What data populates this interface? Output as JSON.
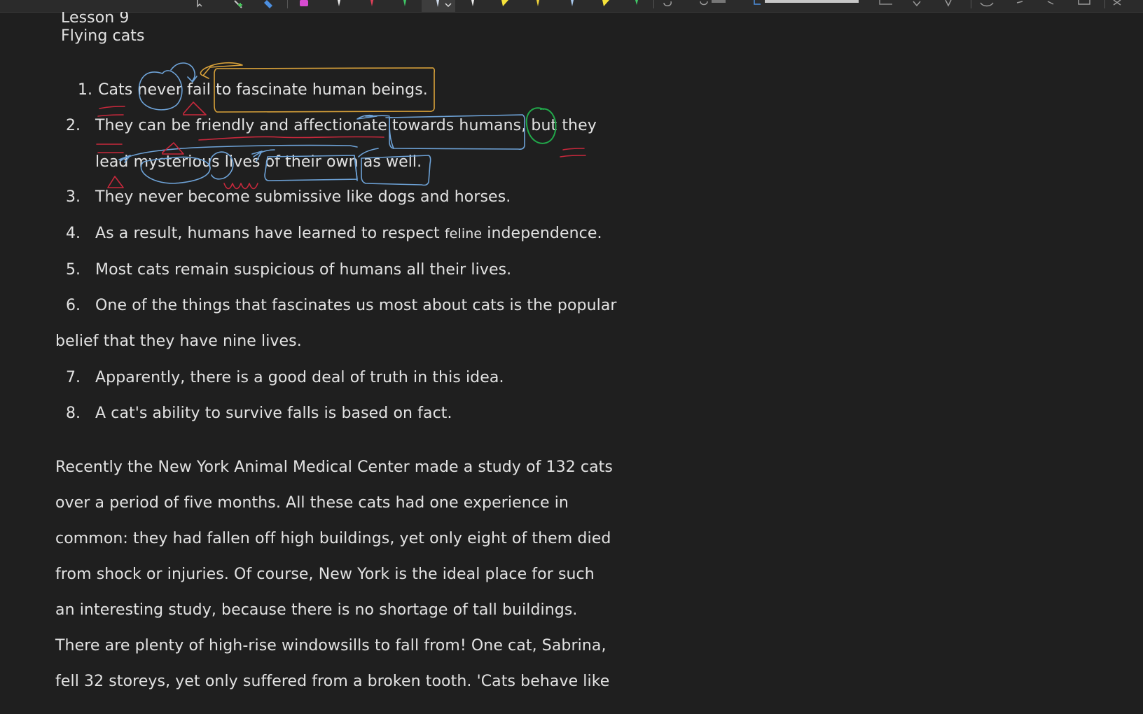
{
  "header": {
    "lesson": "Lesson 9",
    "title": "Flying cats"
  },
  "list": [
    {
      "num": "1.",
      "text": "Cats never fail to fascinate human beings."
    },
    {
      "num": "2.",
      "line1": "They can be friendly and affectionate towards humans, but they",
      "line2": "lead mysterious lives of their own as well."
    },
    {
      "num": "3.",
      "text": "They never become submissive like dogs and horses."
    },
    {
      "num": "4.",
      "text_a": "As a result, humans have learned to respect ",
      "text_small": "feline",
      "text_b": " independence."
    },
    {
      "num": "5.",
      "text": "Most cats remain suspicious of humans all their lives."
    },
    {
      "num": "6.",
      "line1": "One of the things that fascinates us most about cats is the popular",
      "line2": "belief that they have nine lives."
    },
    {
      "num": "7.",
      "text": "Apparently, there is a good deal of truth in this idea."
    },
    {
      "num": "8.",
      "text": "A cat's ability to survive falls is based on fact."
    }
  ],
  "paragraph": [
    "Recently the New York Animal Medical Center made a study of 132 cats",
    "over a period of five months. All these cats had one experience in",
    "common: they had fallen off high buildings, yet only eight of them died",
    "from shock or injuries. Of course, New York is the ideal place for such",
    "an interesting study, because there is no shortage of tall buildings.",
    "There are plenty of high-rise windowsills to fall from! One cat, Sabrina,",
    "fell 32 storeys, yet only suffered from a broken tooth. 'Cats behave like"
  ],
  "toolbar": {
    "icons": [
      "cursor-icon",
      "add-pen-icon",
      "eraser-icon",
      "purple-pen-icon",
      "white-pen-icon",
      "red-pen-icon",
      "green-pen-icon",
      "blue-pen-icon",
      "white-pen-2-icon",
      "yellow-highlighter-icon",
      "yellow-pen-icon",
      "blue-pen-2-icon",
      "yellow-highlighter-2-icon",
      "green-pen-2-icon",
      "lasso-icon",
      "undo-icon",
      "shapes-icon",
      "redo-icon",
      "settings-icon",
      "back-icon",
      "forward-icon",
      "maximize-icon",
      "close-icon"
    ]
  },
  "colors": {
    "background": "#1f1f1f",
    "text": "#e2e2e2",
    "ink_blue": "#6ea3d8",
    "ink_red": "#c8283c",
    "ink_orange": "#d9a23a",
    "ink_green": "#21a84a"
  }
}
